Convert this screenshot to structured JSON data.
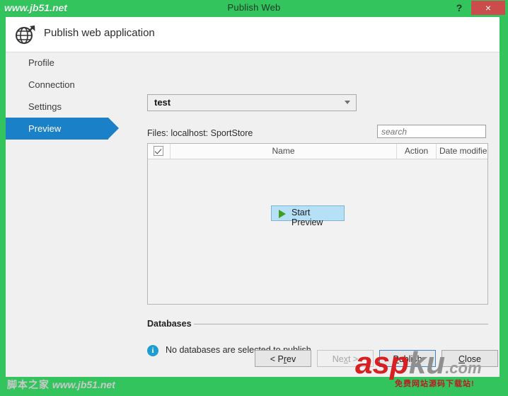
{
  "titlebar": {
    "watermark_left": "www.jb51.net",
    "title": "Publish Web",
    "help_label": "?",
    "close_label": "×"
  },
  "header": {
    "icon": "globe-publish-icon",
    "title": "Publish web application"
  },
  "sidebar": {
    "items": [
      {
        "label": "Profile",
        "active": false
      },
      {
        "label": "Connection",
        "active": false
      },
      {
        "label": "Settings",
        "active": false
      },
      {
        "label": "Preview",
        "active": true
      }
    ]
  },
  "main": {
    "profile_select": {
      "value": "test",
      "arrow_icon": "chevron-down-icon"
    },
    "files_label": "Files:  localhost: SportStore",
    "search": {
      "placeholder": "search",
      "value": "",
      "icon": "search-input"
    },
    "filelist": {
      "columns": [
        {
          "key": "checkbox",
          "label": ""
        },
        {
          "key": "name",
          "label": "Name"
        },
        {
          "key": "action",
          "label": "Action"
        },
        {
          "key": "date",
          "label": "Date modifie"
        }
      ],
      "header_checkbox_checked": true,
      "rows": [],
      "empty_action": {
        "label": "Start Preview",
        "icon": "play-triangle-icon"
      }
    },
    "databases": {
      "title": "Databases",
      "info_icon": "info-circle-icon",
      "info_glyph": "i",
      "message": "No databases are selected to publish"
    }
  },
  "footer": {
    "buttons": [
      {
        "id": "prev",
        "label": "< Prev",
        "accel_before": "< P",
        "accel": "r",
        "accel_after": "ev",
        "disabled": false,
        "primary": false
      },
      {
        "id": "next",
        "label": "Next >",
        "accel_before": "Ne",
        "accel": "x",
        "accel_after": "t >",
        "disabled": true,
        "primary": false
      },
      {
        "id": "publish",
        "label": "Publish",
        "accel_before": "",
        "accel": "P",
        "accel_after": "ublish",
        "disabled": false,
        "primary": true
      },
      {
        "id": "close",
        "label": "Close",
        "accel_before": "",
        "accel": "C",
        "accel_after": "lose",
        "disabled": false,
        "primary": false
      }
    ]
  },
  "watermarks": {
    "bottom_left_cn": "脚本之家",
    "bottom_left_url": "www.jb51.net",
    "aspku_part1": "asp",
    "aspku_part2": "ku",
    "aspku_part3": ".com",
    "aspku_sub": "免费网站源码下载站!"
  },
  "colors": {
    "window_chrome": "#33c45e",
    "close_button": "#cc4b4b",
    "active_step": "#1a80c8",
    "info_icon": "#1e9ed0",
    "play_icon": "#3e9e23",
    "preview_button_bg": "#b6e0f5"
  }
}
